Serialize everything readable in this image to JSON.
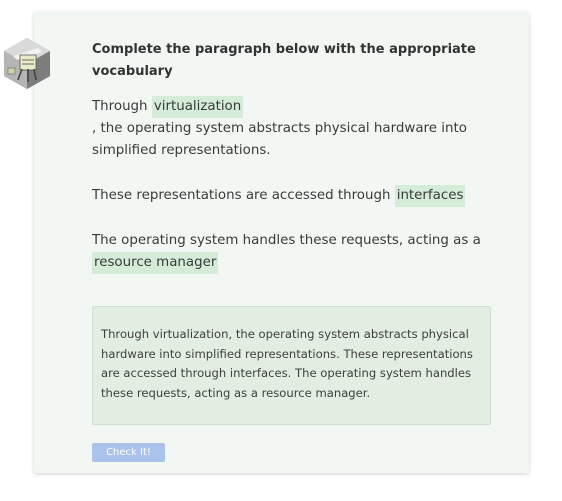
{
  "activity": {
    "title": "Complete the paragraph below with the appropriate vocabulary",
    "icon": "server-rack-icon"
  },
  "paragraphs": [
    {
      "before": "Through ",
      "blank": "virtualization",
      "after": ", the operating system abstracts physical hardware into simplified representations."
    },
    {
      "before": "These representations are accessed through ",
      "blank": "interfaces",
      "after": ""
    },
    {
      "before": "The operating system handles these requests, acting as a ",
      "blank": "resource manager",
      "after": ""
    }
  ],
  "summary": {
    "text": "Through virtualization, the operating system abstracts physical hardware into simplified representations. These representations are accessed through interfaces. The operating system handles these requests, acting as a resource manager."
  },
  "buttons": {
    "check_label": "Check It!"
  },
  "colors": {
    "card_bg": "#f3f7f3",
    "blank_bg": "#d4ecd8",
    "summary_bg": "#e2eee2",
    "button_bg": "#a9c3ec"
  }
}
